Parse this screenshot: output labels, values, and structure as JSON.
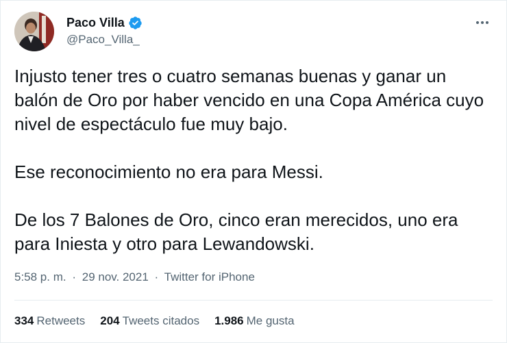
{
  "author": {
    "display_name": "Paco Villa",
    "handle": "@Paco_Villa_",
    "verified": true,
    "verified_icon": "verified-badge-icon",
    "verified_color": "#1d9bf0"
  },
  "menu": {
    "icon": "more-options-icon"
  },
  "tweet": {
    "paragraphs": [
      "Injusto tener tres o cuatro semanas buenas y ganar un balón de Oro por haber vencido en una Copa América cuyo nivel de espectáculo fue muy bajo.",
      "Ese reconocimiento no era para Messi.",
      "De los 7 Balones de Oro, cinco eran merecidos, uno era para Iniesta y otro para Lewandowski."
    ]
  },
  "meta": {
    "time": "5:58 p. m.",
    "separator": "·",
    "date": "29 nov. 2021",
    "source": "Twitter for iPhone"
  },
  "stats": {
    "retweets": {
      "count": "334",
      "label": "Retweets"
    },
    "quotes": {
      "count": "204",
      "label": "Tweets citados"
    },
    "likes": {
      "count": "1.986",
      "label": "Me gusta"
    }
  },
  "colors": {
    "text": "#0f1419",
    "secondary": "#536471",
    "border": "#e6ecf0"
  }
}
